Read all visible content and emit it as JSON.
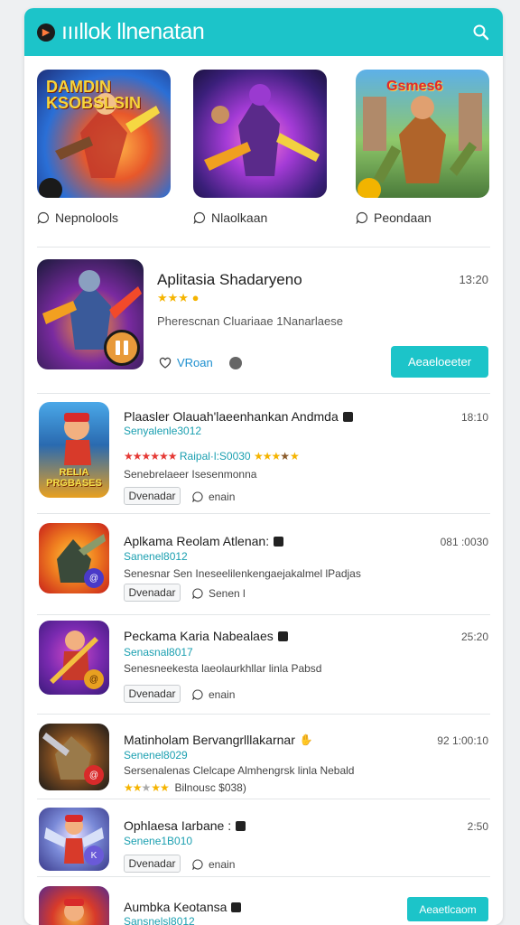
{
  "header": {
    "title": "ıııllok llnenatan",
    "logo": "play-logo-icon",
    "search_icon": "search-icon"
  },
  "featured": [
    {
      "cap": "Nepnolools",
      "icon": "chat-bubble-icon",
      "art_title": "DAMDIN KSOBSLSIN"
    },
    {
      "cap": "Nlaolkaan",
      "icon": "chat-bubble-icon",
      "art_title": ""
    },
    {
      "cap": "Peondaan",
      "icon": "chat-bubble-icon",
      "art_title": "Gsmes6"
    }
  ],
  "hero": {
    "name": "Aplitasia Shadaryeno",
    "time": "13:20",
    "stars": "★★★ ●",
    "desc": "Pherescnan Cluariaae  1Nanarlaese",
    "likes": "VRoan",
    "cta": "Aeaeloeeter"
  },
  "apps": [
    {
      "name": "Plaasler Olauah'laeenhankan Andmda",
      "sub": "Senyalenle3012",
      "rating": "Raipal·l:S0030",
      "desc": "Senebrelaeer Isesenmonna",
      "btn": "Dvenadar",
      "meta": "enain",
      "time": "18:10"
    },
    {
      "name": "Aplkama Reolam Atlenan:",
      "sub": "Sanenel8012",
      "desc": "Senesnar Sen Ineseelilenkengaejakalmel lPadjas",
      "btn": "Dvenadar",
      "meta": "Senen l",
      "time": "081 :0030"
    },
    {
      "name": "Peckama Karia Nabealaes",
      "sub": "Senasnal8017",
      "desc": "Senesneekesta laeolaurkhllar  linla Pabsd",
      "btn": "Dvenadar",
      "meta": "enain",
      "time": "25:20"
    },
    {
      "name": "Matinholam Bervangrlllakarnar",
      "sub": "Senenel8029",
      "desc": "Sersenalenas Clelcape Almhengrsk  linla Nebald",
      "rating": "Bilnousc $038)",
      "time": "92 1:00:10"
    },
    {
      "name": "Ophlaesa Iarbane :",
      "sub": "Senene1B010",
      "btn": "Dvenadar",
      "meta": "enain",
      "time": "2:50"
    },
    {
      "name": "Aumbka Keotansa",
      "sub": "Sansnelsl8012",
      "cta": "Aeaetlcaom"
    }
  ]
}
